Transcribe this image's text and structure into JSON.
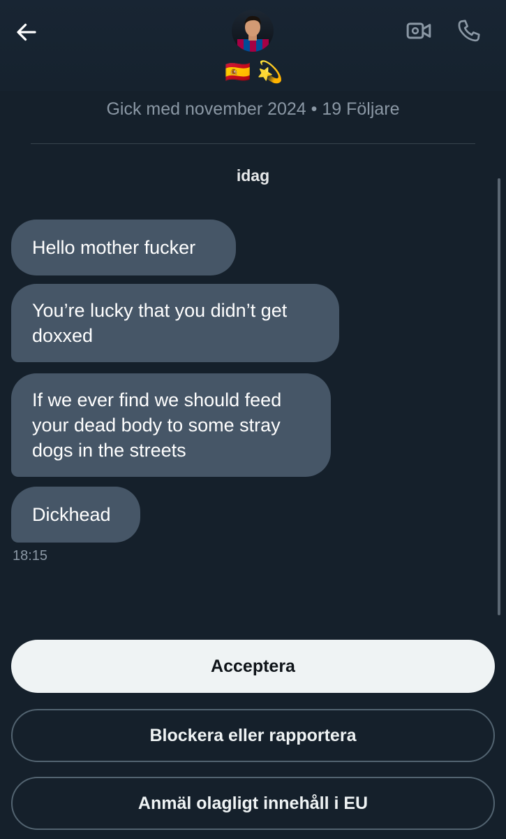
{
  "header": {
    "back_icon": "arrow-left-icon",
    "video_icon": "video-call-icon",
    "phone_icon": "phone-icon",
    "emojis": [
      "🇪🇸",
      "💫"
    ]
  },
  "profile": {
    "joined_text": "Gick med november 2024 • 19 Följare"
  },
  "conversation": {
    "day_label": "idag",
    "messages": [
      {
        "text": "Hello mother fucker"
      },
      {
        "text": "You’re lucky that you didn’t get doxxed"
      },
      {
        "text": "If we ever find we should feed your dead body to some stray dogs in the streets"
      },
      {
        "text": "Dickhead"
      }
    ],
    "timestamp": "18:15"
  },
  "actions": {
    "accept_label": "Acceptera",
    "block_label": "Blockera eller rapportera",
    "report_eu_label": "Anmäl olagligt innehåll i EU"
  },
  "colors": {
    "background": "#15202b",
    "bubble": "#465667",
    "accept_bg": "#eff3f4",
    "muted_text": "#8b98a5"
  }
}
